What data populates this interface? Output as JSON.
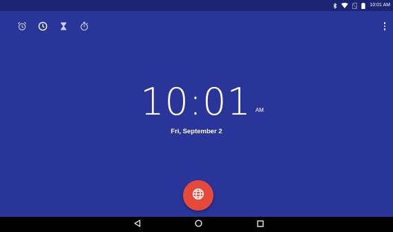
{
  "status_bar": {
    "time": "10:01 AM",
    "icons": [
      "bluetooth-icon",
      "wifi-icon",
      "no-sim-icon",
      "battery-icon"
    ]
  },
  "tabs": [
    {
      "name": "alarm",
      "icon": "alarm-clock-icon"
    },
    {
      "name": "clock",
      "icon": "clock-icon",
      "selected": true
    },
    {
      "name": "timer",
      "icon": "hourglass-icon"
    },
    {
      "name": "stopwatch",
      "icon": "stopwatch-icon"
    }
  ],
  "clock": {
    "time": "10:01",
    "ampm": "AM",
    "date": "Fri, September 2"
  },
  "fab": {
    "icon": "globe-icon",
    "color": "#e5493a"
  },
  "nav": {
    "buttons": [
      "back-icon",
      "home-icon",
      "recents-icon"
    ]
  },
  "colors": {
    "background": "#2a359a",
    "status_bar": "#1c2370",
    "nav_bar": "#000000"
  }
}
